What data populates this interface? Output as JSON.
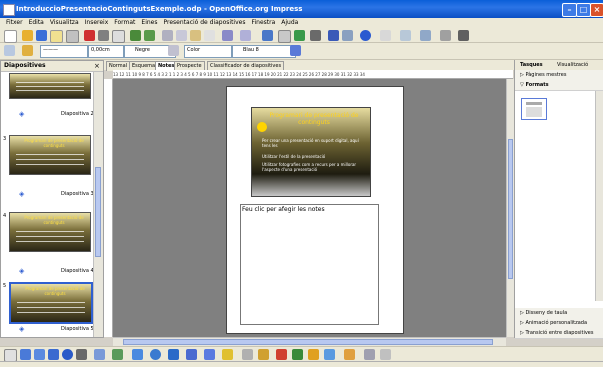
{
  "window": {
    "title": "IntroduccioPresentacioContingutsExemple.odp - OpenOffice.org Impress"
  },
  "menu": [
    "Fitxer",
    "Edita",
    "Visualitza",
    "Insereix",
    "Format",
    "Eines",
    "Presentació de diapositives",
    "Finestra",
    "Ajuda"
  ],
  "line_toolbar": {
    "width": "0,00cm",
    "color": "Negre",
    "area_style": "Color",
    "area_color": "Blau 8"
  },
  "slides_panel": {
    "title": "Diapositives",
    "labels": [
      "Diapositiva 2",
      "Diapositiva 3",
      "Diapositiva 4",
      "Diapositiva 5"
    ],
    "numbers": [
      "3",
      "4",
      "5"
    ],
    "thumb_title": "Programari de presentació de continguts"
  },
  "tabs": [
    "Normal",
    "Esquema",
    "Notes",
    "Prospecte",
    "Classificador de diapositives"
  ],
  "active_tab": "Notes",
  "ruler_text": "13 12 11 10 9 8 7 6 5 4 3 2 1   1 2 3 4 5 6 7 8 9 10 11 12 13 14 15 16 17 18 19 20 21 22 23 24 25 26 27 28 29 30 31 32 33 34",
  "slide": {
    "title": "Programari de presentació de continguts",
    "bullets": [
      "Per crear una presentació en suport digital, aquí tens les",
      "Utilitzar l'estil de la presentació",
      "Utilitzar fotografies com a recurs per a millorar l'aspecte d'una presentació"
    ]
  },
  "notes_text": "Feu clic per afegir les notes",
  "tasks_panel": {
    "title": "Tasques",
    "view_menu": "Visualització",
    "master_pages": "Pàgines mestres",
    "layouts": "Formats",
    "table_design": "Disseny de taula",
    "custom_animation": "Animació personalitzada",
    "slide_transition": "Transició entre diapositives"
  }
}
